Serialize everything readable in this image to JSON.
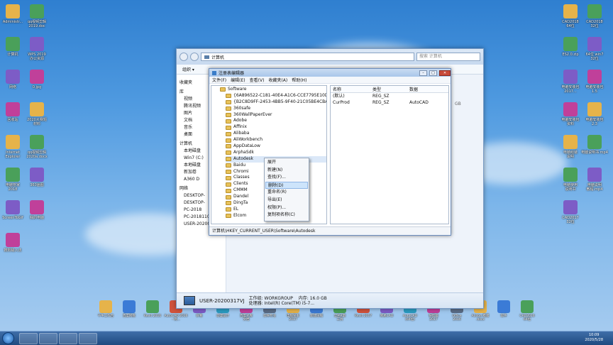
{
  "desktop": {
    "left_icons": [
      {
        "label": "Administr..."
      },
      {
        "label": "qq视频剪辑\n2019.doc"
      },
      {
        "label": "计算机"
      },
      {
        "label": "WPS 2019\n办公资源"
      },
      {
        "label": "网络"
      },
      {
        "label": "0.jpg"
      },
      {
        "label": "回收站"
      },
      {
        "label": "2020大赛题\n材料"
      },
      {
        "label": "Internet\nExplorer"
      },
      {
        "label": "qq视频剪辑\n2020a.docx"
      },
      {
        "label": "电脑管家\n2018"
      },
      {
        "label": "360画图"
      },
      {
        "label": "ScreenToGif"
      },
      {
        "label": "我的电脑"
      },
      {
        "label": "搜狗输入法"
      }
    ],
    "right_icons": [
      {
        "label": "CAD2018\n64位"
      },
      {
        "label": "CAD2018\n32位"
      },
      {
        "label": "ES2.0.zip"
      },
      {
        "label": "64位 win7\n32位"
      },
      {
        "label": "电脑安装包\n2017..."
      },
      {
        "label": "电脑安装包\n1.5"
      },
      {
        "label": "电脑安装包\n资料"
      },
      {
        "label": "电脑安装包\n2.3"
      },
      {
        "label": "电脑组装\n说明"
      },
      {
        "label": "电脑说明书.mp4"
      },
      {
        "label": "电脑使用\n说明书"
      },
      {
        "label": "电脑说明\n教程.mp4"
      },
      {
        "label": "CAD2017\n32位"
      }
    ],
    "bottom_icons": [
      {
        "label": "千牛工作台"
      },
      {
        "label": "百度网盘"
      },
      {
        "label": "Revit 2016"
      },
      {
        "label": "AutoCAD 2016 - 简..."
      },
      {
        "label": "好看"
      },
      {
        "label": "动漫设计"
      },
      {
        "label": "百度文库\n文档"
      },
      {
        "label": "剪映专业"
      },
      {
        "label": "电脑管家\n2017"
      },
      {
        "label": "新建压缩"
      },
      {
        "label": "全民K歌\n工具"
      },
      {
        "label": "Revit 2017"
      },
      {
        "label": "简易CAD"
      },
      {
        "label": "AutoCAD\n(64位)"
      },
      {
        "label": "快剪辑\n2017"
      },
      {
        "label": "Office\n2016"
      },
      {
        "label": "Adobe 模版\n.docx"
      },
      {
        "label": "软件"
      },
      {
        "label": "CAD2016\n64位"
      }
    ]
  },
  "explorer": {
    "address": "计算机",
    "search_placeholder": "搜索 计算机",
    "toolbar": [
      "组织 ▾"
    ],
    "nav_items": [
      "收藏夹",
      "库",
      "视频",
      "腾讯视频",
      "图片",
      "文档",
      "音乐",
      "桌面",
      "计算机",
      "本地磁盘",
      "Win7 (C:)",
      "本地磁盘",
      "新加卷",
      "A360 D",
      "网络",
      "DESKTOP-",
      "DESKTOP-",
      "PC-2018",
      "PC-20181109RLDV",
      "USER-20200317VJ"
    ],
    "size_hint": "GB",
    "status": {
      "name": "USER-20200317VJ",
      "workgroup_label": "工作组:",
      "workgroup": "WORKGROUP",
      "memory_label": "内存:",
      "memory": "16.0 GB",
      "cpu_label": "处理器:",
      "cpu": "Intel(R) Core(TM) i5-7..."
    }
  },
  "regedit": {
    "title": "注册表编辑器",
    "menu": [
      "文件(F)",
      "编辑(E)",
      "查看(V)",
      "收藏夹(A)",
      "帮助(H)"
    ],
    "tree": [
      "Software",
      "{6A896522-C181-40E4-A1C6-CCE7795E10D3}",
      "{B2C8D9FF-2453-4BB5-9F40-21C05BE4CBA8}",
      "360safe",
      "360WallPaperEver",
      "Adobe",
      "Affinix",
      "Alibaba",
      "AliWorkbench",
      "AppDataLow",
      "ArphaSdk",
      "Autodesk",
      "Baidu",
      "Chromi",
      "Classes",
      "Clients",
      "CMMM",
      "Dandel",
      "DingTa",
      "EL",
      "Elcom"
    ],
    "list_headers": [
      "名称",
      "类型",
      "数据"
    ],
    "list_rows": [
      {
        "name": "(默认)",
        "type": "REG_SZ",
        "data": ""
      },
      {
        "name": "CurProd",
        "type": "REG_SZ",
        "data": "AutoCAD"
      }
    ],
    "status_path": "计算机\\HKEY_CURRENT_USER\\Software\\Autodesk"
  },
  "context_menu": {
    "items": [
      "展开",
      "新建(N)",
      "查找(F)...",
      "删除(D)",
      "重命名(R)",
      "导出(E)",
      "权限(P)...",
      "复制项名称(C)"
    ],
    "highlighted_index": 3
  },
  "taskbar": {
    "time": "10:09",
    "date": "2020/5/28"
  },
  "colors": {
    "sky_top": "#2f7fd0",
    "taskbar": "#1f4a80",
    "folder": "#e8c25a",
    "highlight": "#cde4fb"
  }
}
